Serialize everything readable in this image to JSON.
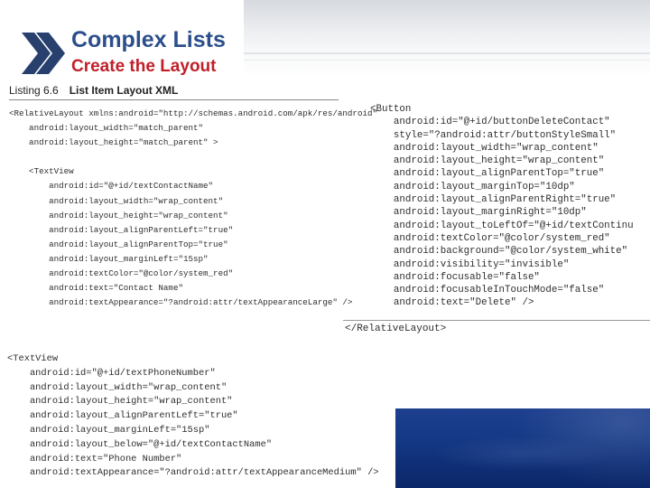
{
  "slide": {
    "title": "Complex Lists",
    "subtitle": "Create the Layout",
    "logo_icon": "double-chevron-right-icon",
    "colors": {
      "title": "#2c4f8c",
      "subtitle": "#c0202a",
      "accent_blue": "#163a87"
    }
  },
  "listing": {
    "number": "Listing 6.6",
    "name": "List Item Layout XML"
  },
  "code_left_top": [
    "<RelativeLayout xmlns:android=\"http://schemas.android.com/apk/res/android\"",
    "    android:layout_width=\"match_parent\"",
    "    android:layout_height=\"match_parent\" >",
    "",
    "    <TextView",
    "        android:id=\"@+id/textContactName\"",
    "        android:layout_width=\"wrap_content\"",
    "        android:layout_height=\"wrap_content\"",
    "        android:layout_alignParentLeft=\"true\"",
    "        android:layout_alignParentTop=\"true\"",
    "        android:layout_marginLeft=\"15sp\"",
    "        android:textColor=\"@color/system_red\"",
    "        android:text=\"Contact Name\"",
    "        android:textAppearance=\"?android:attr/textAppearanceLarge\" />"
  ],
  "code_right": [
    "<Button",
    "    android:id=\"@+id/buttonDeleteContact\"",
    "    style=\"?android:attr/buttonStyleSmall\"",
    "    android:layout_width=\"wrap_content\"",
    "    android:layout_height=\"wrap_content\"",
    "    android:layout_alignParentTop=\"true\"",
    "    android:layout_marginTop=\"10dp\"",
    "    android:layout_alignParentRight=\"true\"",
    "    android:layout_marginRight=\"10dp\"",
    "    android:layout_toLeftOf=\"@+id/textContinu",
    "    android:textColor=\"@color/system_red\"",
    "    android:background=\"@color/system_white\"",
    "    android:visibility=\"invisible\"",
    "    android:focusable=\"false\"",
    "    android:focusableInTouchMode=\"false\"",
    "    android:text=\"Delete\" />"
  ],
  "code_end": "</RelativeLayout>",
  "code_left_bottom": [
    "<TextView",
    "    android:id=\"@+id/textPhoneNumber\"",
    "    android:layout_width=\"wrap_content\"",
    "    android:layout_height=\"wrap_content\"",
    "    android:layout_alignParentLeft=\"true\"",
    "    android:layout_marginLeft=\"15sp\"",
    "    android:layout_below=\"@+id/textContactName\"",
    "    android:text=\"Phone Number\"",
    "    android:textAppearance=\"?android:attr/textAppearanceMedium\" />"
  ]
}
